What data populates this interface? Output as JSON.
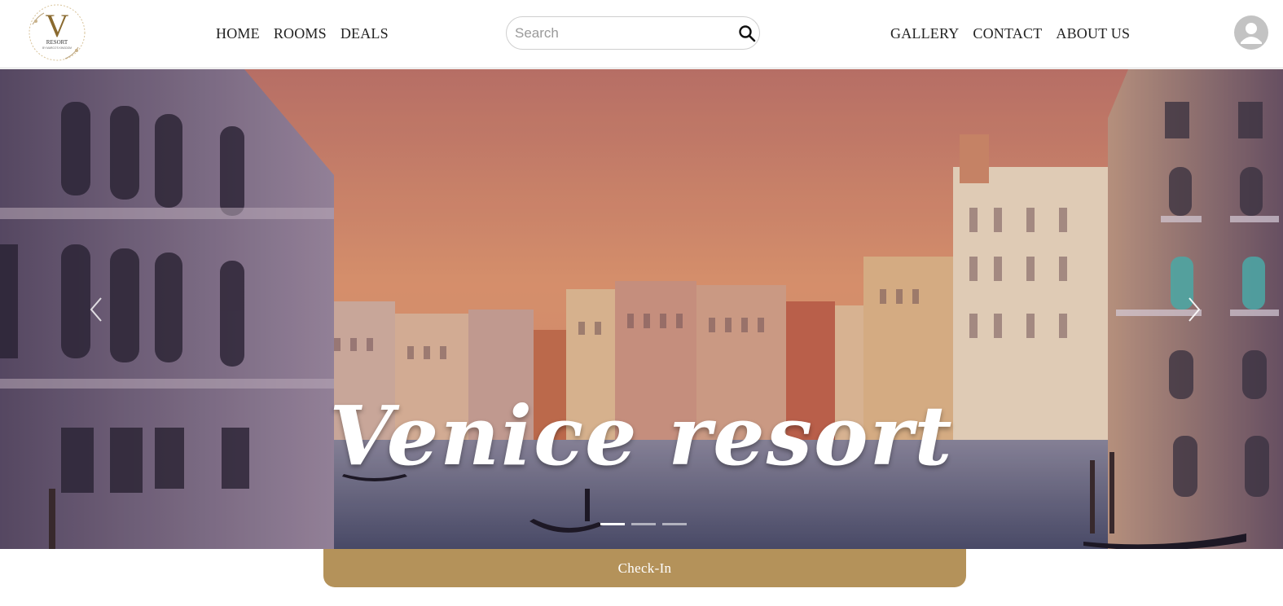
{
  "logo": {
    "letter": "V",
    "name": "RESORT",
    "tagline": "BY MARCO'S KINGDOM"
  },
  "nav": {
    "left": [
      {
        "label": "HOME"
      },
      {
        "label": "ROOMS"
      },
      {
        "label": "DEALS"
      }
    ],
    "right": [
      {
        "label": "GALLERY"
      },
      {
        "label": "CONTACT"
      },
      {
        "label": "ABOUT US"
      }
    ]
  },
  "search": {
    "placeholder": "Search",
    "value": "",
    "icon": "magnifier-icon"
  },
  "account": {
    "icon": "user-avatar-icon"
  },
  "hero": {
    "title": "Venice resort",
    "prev_icon": "chevron-left-icon",
    "next_icon": "chevron-right-icon",
    "slides_total": 3,
    "active_slide": 1
  },
  "checkin": {
    "label": "Check-In"
  },
  "colors": {
    "accent": "#b4925a",
    "sky_top": "#c46a64",
    "sky_bottom": "#e8a06a",
    "avatar_bg": "#c3c3c3"
  }
}
